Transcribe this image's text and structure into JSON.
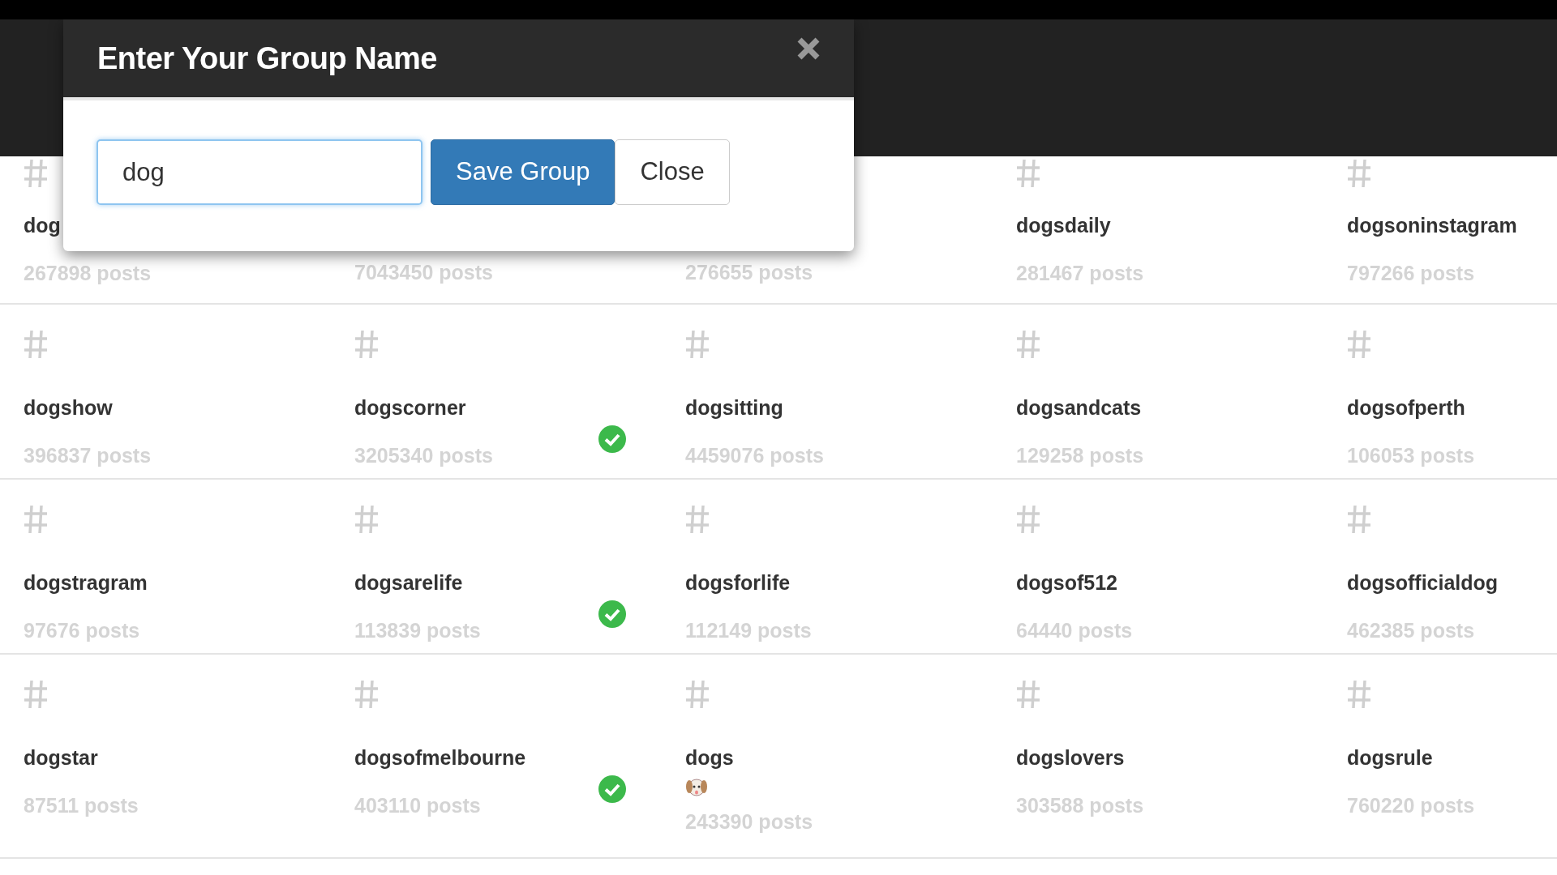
{
  "dialog": {
    "title": "Enter Your Group Name",
    "input": {
      "value": "dog"
    },
    "buttons": [
      {
        "kind": "primary",
        "label": "Save Group"
      },
      {
        "kind": "default",
        "label": "Close"
      }
    ]
  },
  "rows": [
    {
      "cells": [
        {
          "name": "dog",
          "posts": "267898 posts",
          "selected": false
        },
        {
          "posts": "7043450 posts",
          "selected": false
        },
        {
          "posts": "276655 posts",
          "selected": false
        },
        {
          "name": "dogsdaily",
          "posts": "281467 posts",
          "selected": false
        },
        {
          "name": "dogsoninstagram",
          "posts": "797266 posts",
          "selected": false
        }
      ]
    },
    {
      "cells": [
        {
          "name": "dogshow",
          "posts": "396837 posts",
          "selected": false
        },
        {
          "name": "dogscorner",
          "posts": "3205340 posts",
          "selected": true
        },
        {
          "name": "dogsitting",
          "posts": "4459076 posts",
          "selected": false
        },
        {
          "name": "dogsandcats",
          "posts": "129258 posts",
          "selected": false
        },
        {
          "name": "dogsofperth",
          "posts": "106053 posts",
          "selected": false
        }
      ]
    },
    {
      "cells": [
        {
          "name": "dogstragram",
          "posts": "97676 posts",
          "selected": false
        },
        {
          "name": "dogsarelife",
          "posts": "113839 posts",
          "selected": true
        },
        {
          "name": "dogsforlife",
          "posts": "112149 posts",
          "selected": false
        },
        {
          "name": "dogsof512",
          "posts": "64440 posts",
          "selected": false
        },
        {
          "name": "dogsofficialdog",
          "posts": "462385 posts",
          "selected": false
        }
      ]
    },
    {
      "cells": [
        {
          "name": "dogstar",
          "posts": "87511 posts",
          "selected": false
        },
        {
          "name": "dogsofmelbourne",
          "posts": "403110 posts",
          "selected": true
        },
        {
          "name": "dogs",
          "kind": "with_icon",
          "posts": "243390 posts",
          "selected": false
        },
        {
          "name": "dogslovers",
          "posts": "303588 posts",
          "selected": false
        },
        {
          "name": "dogsrule",
          "posts": "760220 posts",
          "selected": false
        }
      ]
    }
  ]
}
